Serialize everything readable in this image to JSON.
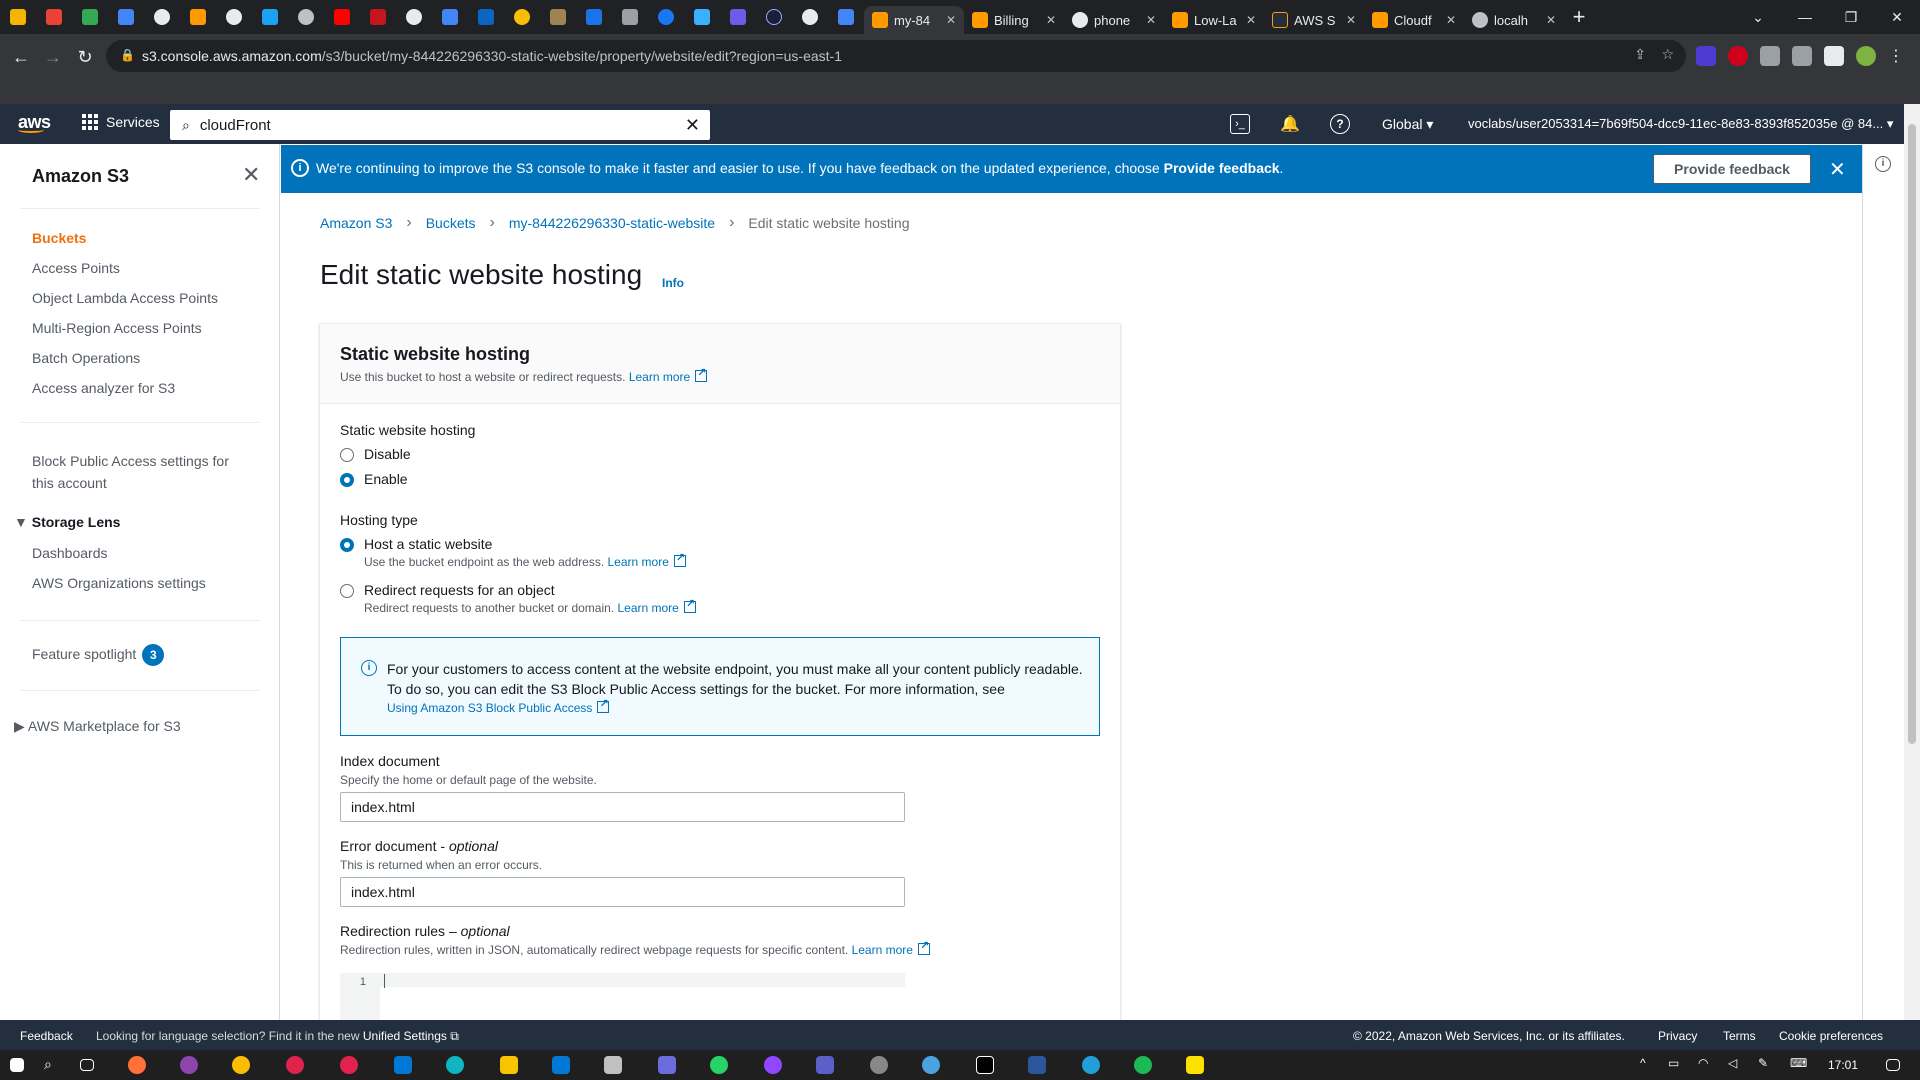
{
  "browser": {
    "tabs": [
      {
        "title": "my-84",
        "icon": "aws-s3-icon",
        "active": true
      },
      {
        "title": "Billing",
        "icon": "aws-icon"
      },
      {
        "title": "phone",
        "icon": "google-icon"
      },
      {
        "title": "Low-La",
        "icon": "aws-icon"
      },
      {
        "title": "AWS S",
        "icon": "aws-icon"
      },
      {
        "title": "Cloudf",
        "icon": "aws-icon"
      },
      {
        "title": "localh",
        "icon": "globe-icon"
      }
    ],
    "url_host": "s3.console.aws.amazon.com",
    "url_path": "/s3/bucket/my-844226296330-static-website/property/website/edit?region=us-east-1"
  },
  "awsnav": {
    "logo": "aws",
    "services": "Services",
    "search_value": "cloudFront",
    "region": "Global",
    "account": "voclabs/user2053314=7b69f504-dcc9-11ec-8e83-8393f852035e @ 84..."
  },
  "sidebar": {
    "title": "Amazon S3",
    "items": [
      "Buckets",
      "Access Points",
      "Object Lambda Access Points",
      "Multi-Region Access Points",
      "Batch Operations",
      "Access analyzer for S3"
    ],
    "block_public_line1": "Block Public Access settings for",
    "block_public_line2": "this account",
    "storage_lens": "Storage Lens",
    "storage_lens_items": [
      "Dashboards",
      "AWS Organizations settings"
    ],
    "feature_spotlight": "Feature spotlight",
    "feature_spotlight_count": "3",
    "marketplace": "AWS Marketplace for S3"
  },
  "banner": {
    "message": "We're continuing to improve the S3 console to make it faster and easier to use. If you have feedback on the updated experience, choose",
    "message_bold": "Provide feedback",
    "button": "Provide feedback"
  },
  "breadcrumb": [
    "Amazon S3",
    "Buckets",
    "my-844226296330-static-website",
    "Edit static website hosting"
  ],
  "page": {
    "title": "Edit static website hosting",
    "info": "Info"
  },
  "panel": {
    "title": "Static website hosting",
    "desc": "Use this bucket to host a website or redirect requests.",
    "learn_more": "Learn more",
    "hosting_label": "Static website hosting",
    "disable": "Disable",
    "enable": "Enable",
    "hosting_type_label": "Hosting type",
    "host_static": "Host a static website",
    "host_static_desc": "Use the bucket endpoint as the web address.",
    "redirect": "Redirect requests for an object",
    "redirect_desc": "Redirect requests to another bucket or domain.",
    "alert_text": "For your customers to access content at the website endpoint, you must make all your content publicly readable. To do so, you can edit the S3 Block Public Access settings for the bucket. For more information, see",
    "alert_link": "Using Amazon S3 Block Public Access",
    "index_label": "Index document",
    "index_desc": "Specify the home or default page of the website.",
    "index_value": "index.html",
    "error_label": "Error document -",
    "error_optional": "optional",
    "error_desc": "This is returned when an error occurs.",
    "error_value": "index.html",
    "redir_label": "Redirection rules –",
    "redir_optional": "optional",
    "redir_desc": "Redirection rules, written in JSON, automatically redirect webpage requests for specific content.",
    "editor_line": "1"
  },
  "footer": {
    "feedback": "Feedback",
    "lang_text": "Looking for language selection? Find it in the new",
    "lang_link": "Unified Settings",
    "copyright": "© 2022, Amazon Web Services, Inc. or its affiliates.",
    "privacy": "Privacy",
    "terms": "Terms",
    "cookies": "Cookie preferences"
  },
  "taskbar": {
    "clock": "17:01"
  },
  "colors": {
    "aws_nav": "#232f3e",
    "accent_orange": "#ec7211",
    "link_blue": "#0073bb"
  }
}
